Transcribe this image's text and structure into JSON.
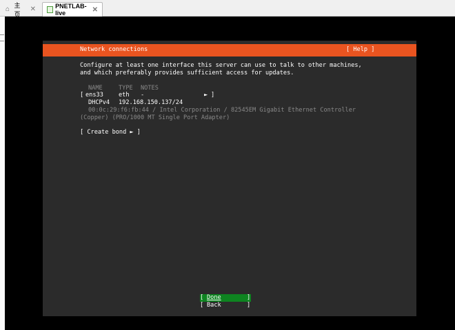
{
  "browser": {
    "tabs": [
      {
        "label": "主页",
        "icon": "home-icon"
      },
      {
        "label": "PNETLAB-live",
        "icon": "vm-icon",
        "active": true
      }
    ],
    "close_glyph": "✕"
  },
  "screen": {
    "title": "Network connections",
    "help": "[ Help ]",
    "intro_line1": "Configure at least one interface this server can use to talk to other machines,",
    "intro_line2": "and which preferably provides sufficient access for updates.",
    "headers": {
      "name": "NAME",
      "type": "TYPE",
      "notes": "NOTES"
    },
    "interface": {
      "bracket_open": "[",
      "name": "ens33",
      "type": "eth",
      "notes": "-",
      "arrow": "►",
      "bracket_close": "]",
      "dhcp_label": "DHCPv4",
      "dhcp_address": "192.168.150.137/24",
      "hw_line1": "00:0c:29:f6:fb:44 / Intel Corporation / 82545EM Gigabit Ethernet Controller",
      "hw_line2": "(Copper) (PRO/1000 MT Single Port Adapter)"
    },
    "create_bond": "[ Create bond ► ]",
    "buttons": {
      "done": {
        "open": "[",
        "label": "Done",
        "close": "]"
      },
      "back": {
        "open": "[",
        "label": "Back",
        "close": "]"
      }
    },
    "colors": {
      "accent": "#e95420",
      "selected": "#0e8420",
      "background": "#2b2b2b"
    }
  }
}
